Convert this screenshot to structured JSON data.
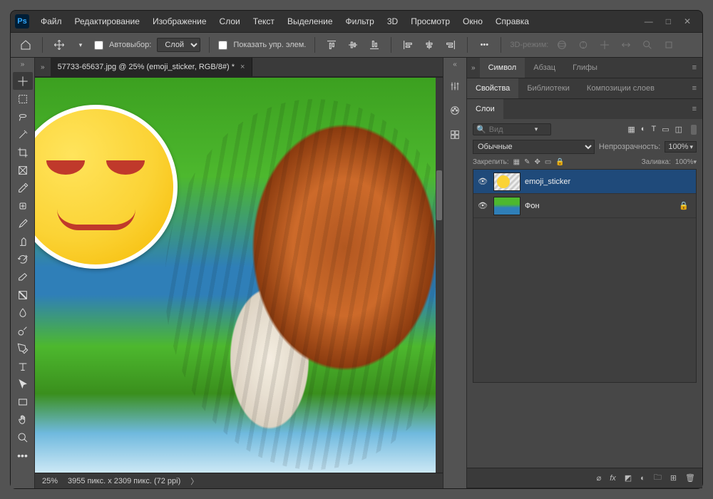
{
  "app": {
    "logo_text": "Ps"
  },
  "menu": [
    "Файл",
    "Редактирование",
    "Изображение",
    "Слои",
    "Текст",
    "Выделение",
    "Фильтр",
    "3D",
    "Просмотр",
    "Окно",
    "Справка"
  ],
  "window_controls": {
    "min": "—",
    "max": "□",
    "close": "✕"
  },
  "optbar": {
    "auto_select_label": "Автовыбор:",
    "auto_select_target": "Слой",
    "show_controls": "Показать упр. элем.",
    "mode_label": "3D-режим:"
  },
  "document": {
    "tab_title": "57733-65637.jpg @ 25% (emoji_sticker, RGB/8#) *",
    "zoom": "25%",
    "dims": "3955 пикс. x 2309 пикс. (72 ppi)"
  },
  "panel_tabs": {
    "char": "Символ",
    "para": "Абзац",
    "glyphs": "Глифы",
    "props": "Свойства",
    "libs": "Библиотеки",
    "comps": "Композиции слоев",
    "layers": "Слои"
  },
  "layers_panel": {
    "search_placeholder": "Вид",
    "blend_mode": "Обычные",
    "opacity_label": "Непрозрачность:",
    "opacity_value": "100%",
    "lock_label": "Закрепить:",
    "fill_label": "Заливка:",
    "fill_value": "100%",
    "layers": [
      {
        "name": "emoji_sticker",
        "selected": true,
        "locked": false,
        "thumb": "emoji"
      },
      {
        "name": "Фон",
        "selected": false,
        "locked": true,
        "thumb": "bg"
      }
    ]
  }
}
